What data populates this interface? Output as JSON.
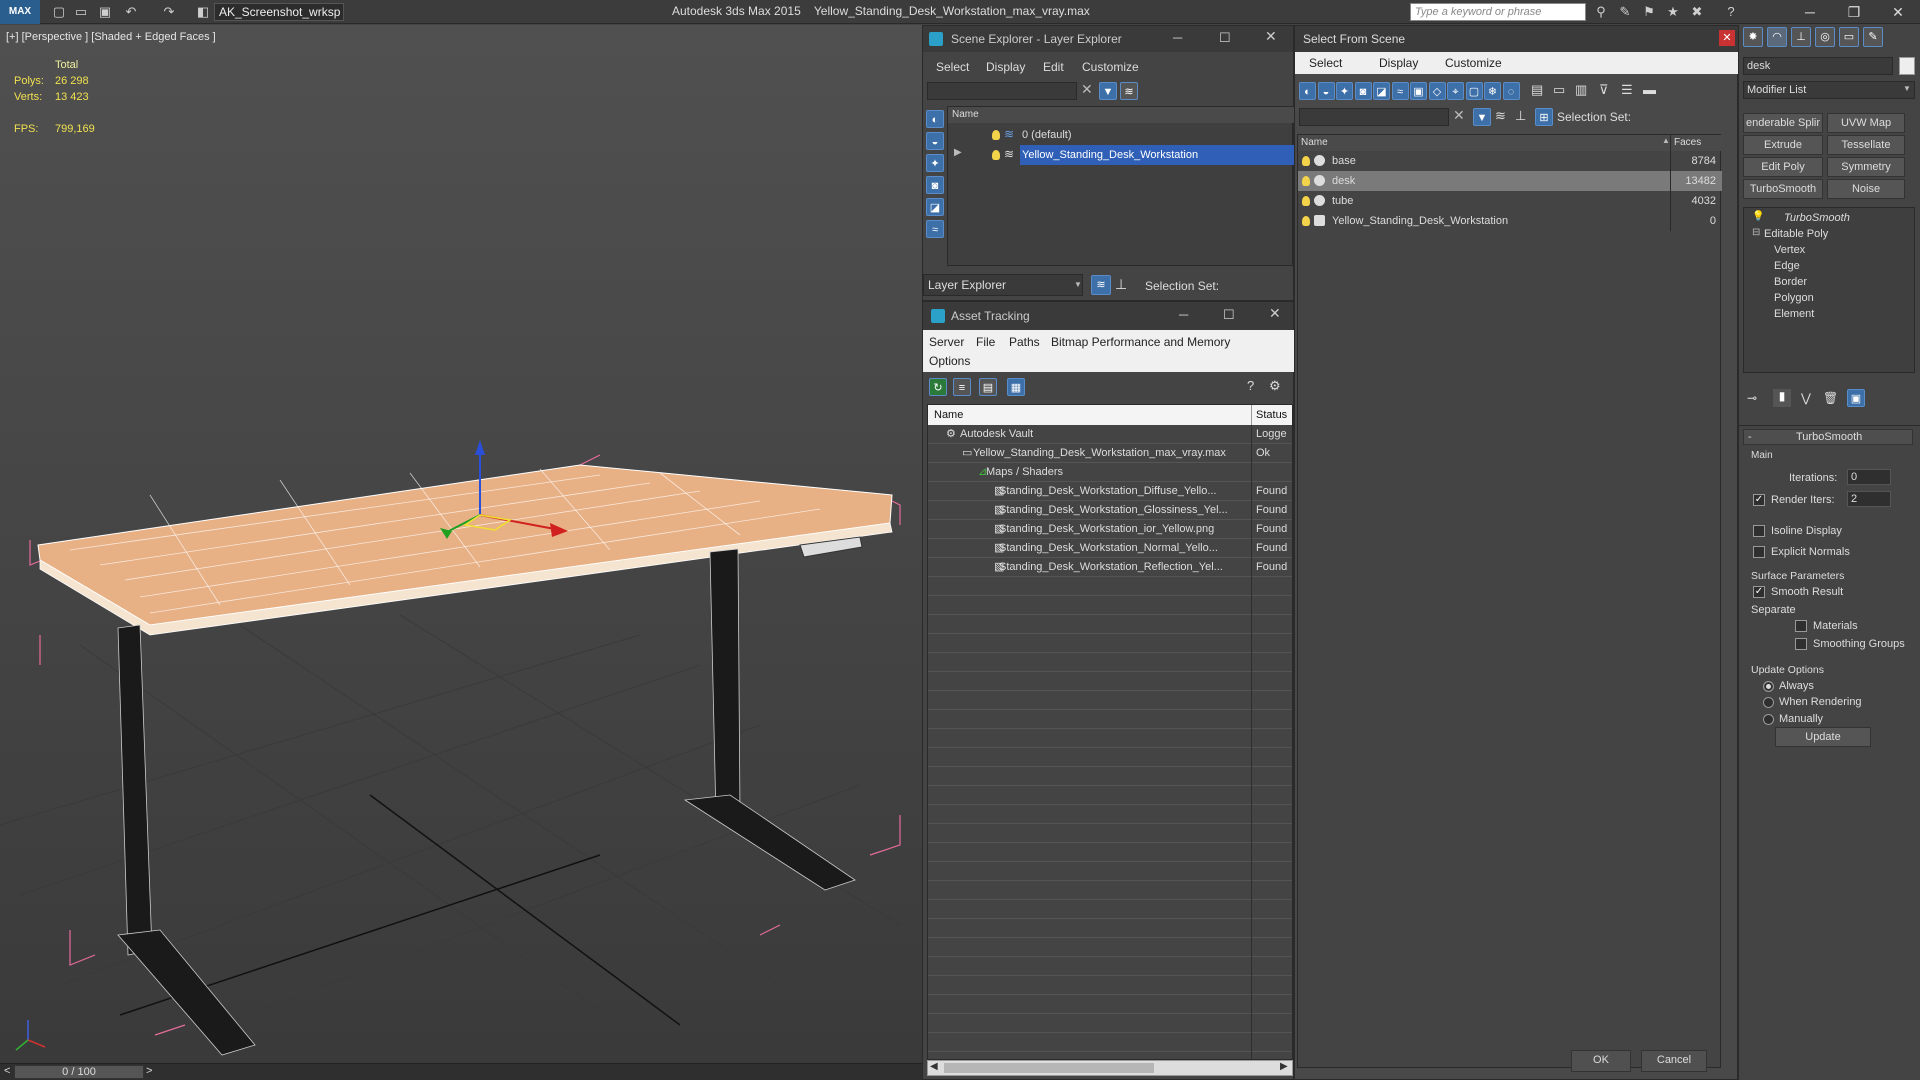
{
  "titlebar": {
    "logo": "MAX",
    "workspace": "AK_Screenshot_wrksp",
    "app_name": "Autodesk 3ds Max  2015",
    "file_name": "Yellow_Standing_Desk_Workstation_max_vray.max",
    "search_placeholder": "Type a keyword or phrase",
    "minimize": "─",
    "restore": "❐",
    "close": "✕"
  },
  "viewport": {
    "label": "[+] [Perspective ] [Shaded + Edged Faces ]",
    "stats_header": "Total",
    "polys_label": "Polys:",
    "polys_value": "26 298",
    "verts_label": "Verts:",
    "verts_value": "13 423",
    "fps_label": "FPS:",
    "fps_value": "799,169",
    "timeline": "0 / 100",
    "timeline_prev": "<",
    "timeline_next": ">"
  },
  "scene_explorer": {
    "title": "Scene Explorer - Layer Explorer",
    "menu": [
      "Select",
      "Display",
      "Edit",
      "Customize"
    ],
    "column_name": "Name",
    "layers": [
      "0 (default)",
      "Yellow_Standing_Desk_Workstation"
    ],
    "footer_label": "Layer Explorer",
    "selection_set_label": "Selection Set:"
  },
  "asset_tracking": {
    "title": "Asset Tracking",
    "menu": [
      "Server",
      "File",
      "Paths",
      "Bitmap Performance and Memory"
    ],
    "menu2": "Options",
    "columns": [
      "Name",
      "Status"
    ],
    "rows": [
      {
        "name": "Autodesk Vault",
        "status": "Logge",
        "indent": 0
      },
      {
        "name": "Yellow_Standing_Desk_Workstation_max_vray.max",
        "status": "Ok",
        "indent": 1
      },
      {
        "name": "Maps / Shaders",
        "status": "",
        "indent": 2
      },
      {
        "name": "Standing_Desk_Workstation_Diffuse_Yello...",
        "status": "Found",
        "indent": 3
      },
      {
        "name": "Standing_Desk_Workstation_Glossiness_Yel...",
        "status": "Found",
        "indent": 3
      },
      {
        "name": "Standing_Desk_Workstation_ior_Yellow.png",
        "status": "Found",
        "indent": 3
      },
      {
        "name": "Standing_Desk_Workstation_Normal_Yello...",
        "status": "Found",
        "indent": 3
      },
      {
        "name": "Standing_Desk_Workstation_Reflection_Yel...",
        "status": "Found",
        "indent": 3
      }
    ]
  },
  "select_from_scene": {
    "title": "Select From Scene",
    "menu": [
      "Select",
      "Display",
      "Customize"
    ],
    "selection_set_label": "Selection Set:",
    "columns": [
      "Name",
      "Faces"
    ],
    "rows": [
      {
        "name": "base",
        "faces": "8784"
      },
      {
        "name": "desk",
        "faces": "13482"
      },
      {
        "name": "tube",
        "faces": "4032"
      },
      {
        "name": "Yellow_Standing_Desk_Workstation",
        "faces": "0"
      }
    ],
    "ok": "OK",
    "cancel": "Cancel"
  },
  "command_panel": {
    "object_name": "desk",
    "modifier_list": "Modifier List",
    "buttons": [
      "enderable Splir",
      "UVW Map",
      "Extrude",
      "Tessellate",
      "Edit Poly",
      "Symmetry",
      "TurboSmooth",
      "Noise"
    ],
    "stack": [
      "TurboSmooth",
      "Editable Poly",
      "Vertex",
      "Edge",
      "Border",
      "Polygon",
      "Element"
    ],
    "rollout_title": "TurboSmooth",
    "main_label": "Main",
    "iterations_label": "Iterations:",
    "iterations_value": "0",
    "render_iters_label": "Render Iters:",
    "render_iters_value": "2",
    "isoline": "Isoline Display",
    "explicit_normals": "Explicit Normals",
    "surface_params": "Surface Parameters",
    "smooth_result": "Smooth Result",
    "separate": "Separate",
    "materials": "Materials",
    "smoothing_groups": "Smoothing Groups",
    "update_options": "Update Options",
    "always": "Always",
    "when_rendering": "When Rendering",
    "manually": "Manually",
    "update_button": "Update"
  },
  "colors": {
    "accent": "#2f5fb7",
    "desk_top": "#e8b085",
    "stat_text": "#f0e050"
  }
}
